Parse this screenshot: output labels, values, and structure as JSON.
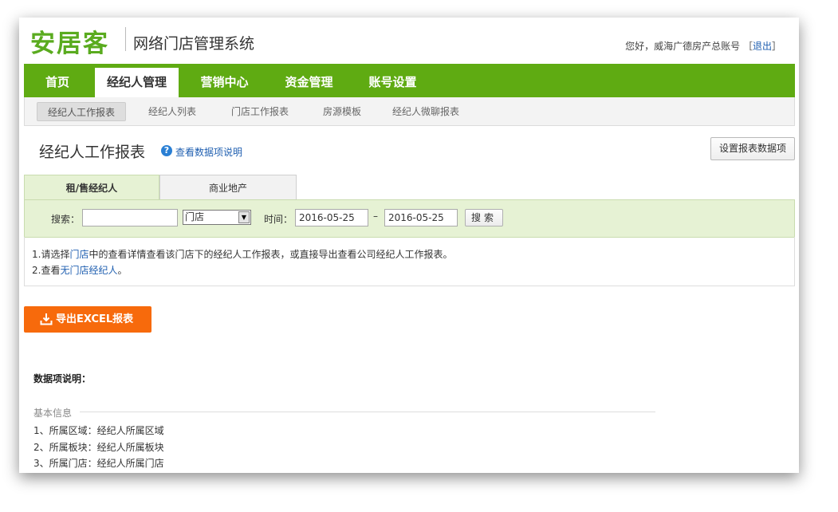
{
  "header": {
    "logo_text": "安居客",
    "system_title": "网络门店管理系统",
    "greeting": "您好，威海广德房产总账号",
    "bracket_open": "［",
    "logout_label": "退出",
    "bracket_close": "］"
  },
  "main_nav": {
    "tabs": [
      {
        "label": "首页"
      },
      {
        "label": "经纪人管理",
        "active": true
      },
      {
        "label": "营销中心"
      },
      {
        "label": "资金管理"
      },
      {
        "label": "账号设置"
      }
    ]
  },
  "sub_nav": {
    "items": [
      {
        "label": "经纪人工作报表",
        "active": true
      },
      {
        "label": "经纪人列表"
      },
      {
        "label": "门店工作报表"
      },
      {
        "label": "房源模板"
      },
      {
        "label": "经纪人微聊报表"
      }
    ]
  },
  "page": {
    "title": "经纪人工作报表",
    "help_link": "查看数据项说明",
    "settings_button": "设置报表数据项"
  },
  "filter_tabs": [
    {
      "label": "租/售经纪人",
      "active": true
    },
    {
      "label": "商业地产"
    }
  ],
  "filter": {
    "search_label": "搜索：",
    "search_value": "",
    "select_value": "门店",
    "time_label": "时间：",
    "start_date": "2016-05-25",
    "dash": "–",
    "end_date": "2016-05-25",
    "search_button": "搜索"
  },
  "notes": {
    "line1_prefix": "1.请选择",
    "line1_link": "门店",
    "line1_suffix": "中的查看详情查看该门店下的经纪人工作报表，或直接导出查看公司经纪人工作报表。",
    "line2_prefix": "2.查看",
    "line2_link": "无门店经纪人",
    "line2_suffix": "。"
  },
  "export_button": "导出EXCEL报表",
  "description": {
    "title": "数据项说明：",
    "section_label": "基本信息",
    "items": [
      "1、所属区域：经纪人所属区域",
      "2、所属板块：经纪人所属板块",
      "3、所属门店：经纪人所属门店"
    ]
  },
  "colors": {
    "brand_green": "#5fab12",
    "export_orange": "#f76a0c",
    "link_blue": "#1f5fb0"
  }
}
